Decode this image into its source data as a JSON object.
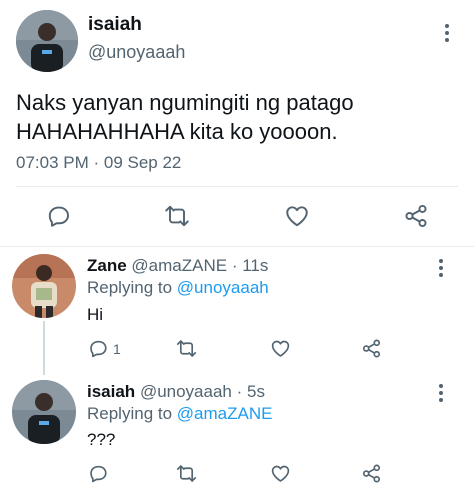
{
  "main_tweet": {
    "display_name": "isaiah",
    "handle": "@unoyaaah",
    "text_line1": "Naks yanyan ngumingiti ng patago",
    "text_line2": "HAHAHAHHAHA kita ko yoooon.",
    "timestamp": "07:03 PM · 09 Sep 22"
  },
  "replies": [
    {
      "display_name": "Zane",
      "handle": "@amaZANE",
      "time": "· 11s",
      "replying_label": "Replying to",
      "replying_to": "@unoyaaah",
      "text": "Hi",
      "reply_count": "1"
    },
    {
      "display_name": "isaiah",
      "handle": "@unoyaaah",
      "time": "· 5s",
      "replying_label": "Replying to",
      "replying_to": "@amaZANE",
      "text": "???"
    }
  ],
  "icons": [
    "reply-icon",
    "retweet-icon",
    "like-icon",
    "share-icon",
    "more-icon"
  ]
}
